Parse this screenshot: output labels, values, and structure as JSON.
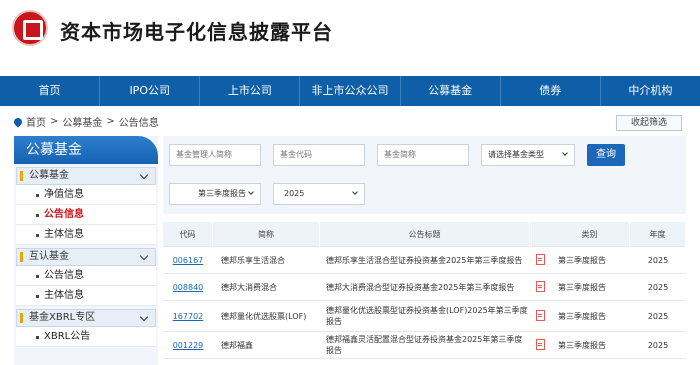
{
  "header": {
    "title": "资本市场电子化信息披露平台"
  },
  "nav": {
    "items": [
      "首页",
      "IPO公司",
      "上市公司",
      "非上市公众公司",
      "公募基金",
      "债券",
      "中介机构"
    ]
  },
  "breadcrumb": {
    "home": "首页",
    "section": "公募基金",
    "page": "公告信息"
  },
  "collapse_label": "收起筛选",
  "sidebar": {
    "title": "公募基金",
    "groups": [
      {
        "label": "公募基金",
        "items": [
          "净值信息",
          "公告信息",
          "主体信息"
        ],
        "active": "公告信息"
      },
      {
        "label": "互认基金",
        "items": [
          "公告信息",
          "主体信息"
        ]
      },
      {
        "label": "基金XBRL专区",
        "items": [
          "XBRL公告"
        ]
      }
    ]
  },
  "filter": {
    "manager_placeholder": "基金管理人简称",
    "code_placeholder": "基金代码",
    "name_placeholder": "基金简称",
    "type_select": "请选择基金类型",
    "query_label": "查询",
    "report_select": "第三季度报告",
    "year_select": "2025"
  },
  "table": {
    "headers": [
      "代码",
      "简称",
      "公告标题",
      "",
      "类别",
      "年度"
    ],
    "rows": [
      {
        "code": "006167",
        "name": "德邦乐享生活混合",
        "title": "德邦乐享生活混合型证券投资基金2025年第三季度报告",
        "category": "第三季度报告",
        "year": "2025"
      },
      {
        "code": "008840",
        "name": "德邦大消费混合",
        "title": "德邦大消费混合型证券投资基金2025年第三季度报告",
        "category": "第三季度报告",
        "year": "2025"
      },
      {
        "code": "167702",
        "name": "德邦量化优选股票(LOF)",
        "title": "德邦量化优选股票型证券投资基金(LOF)2025年第三季度报告",
        "category": "第三季度报告",
        "year": "2025"
      },
      {
        "code": "001229",
        "name": "德邦福鑫",
        "title": "德邦福鑫灵活配置混合型证券投资基金2025年第三季度报告",
        "category": "第三季度报告",
        "year": "2025"
      }
    ]
  },
  "colors": {
    "nav_bg": "#0f5fa8",
    "active_red": "#c9161c",
    "link_blue": "#1b68b8"
  }
}
